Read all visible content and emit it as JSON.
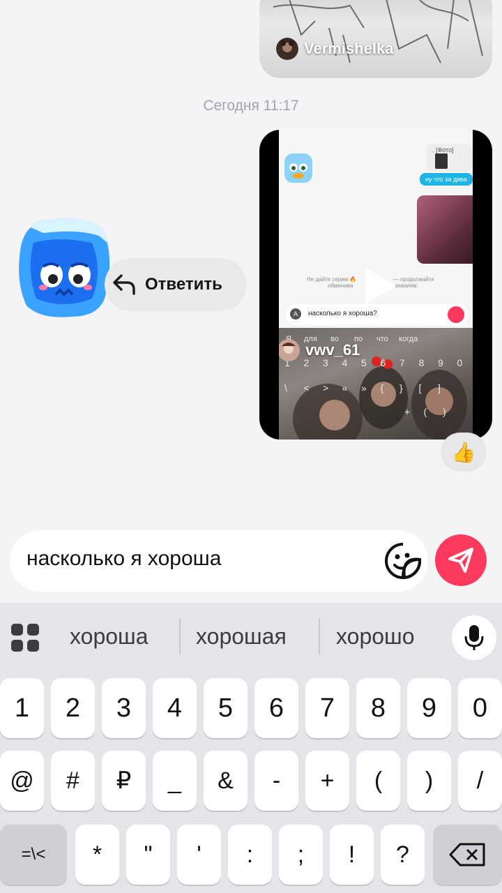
{
  "chat": {
    "prev_video_author": "Vermishelka",
    "date_separator": "Сегодня 11:17",
    "reply_label": "Ответить",
    "main_video": {
      "author": "vwv_61",
      "mini_chat": {
        "top_bubble": ". [Фото]",
        "bubble_text": "ну что за дива",
        "info_left": "Не дайте серим",
        "info_right": "— продолжайте",
        "info_line2_left": "обменива",
        "info_line2_right": "знаниям.",
        "input_text": "насколько я хороша?"
      },
      "mini_keyboard": {
        "suggestions": [
          "Я",
          "для",
          "во",
          "по",
          "что",
          "когда"
        ],
        "digits": [
          "1",
          "2",
          "3",
          "4",
          "5",
          "6",
          "7",
          "8",
          "9",
          "0"
        ],
        "row2": [
          "\\",
          "<",
          ">",
          "«",
          "»",
          "{",
          "}",
          "[",
          "]"
        ],
        "row3": [
          "+",
          "(",
          ")"
        ]
      }
    },
    "reaction": "👍"
  },
  "composer": {
    "value": "насколько я хороша"
  },
  "keyboard": {
    "suggestions": [
      "хороша",
      "хорошая",
      "хорошо"
    ],
    "row1": [
      "1",
      "2",
      "3",
      "4",
      "5",
      "6",
      "7",
      "8",
      "9",
      "0"
    ],
    "row2": [
      "@",
      "#",
      "₽",
      "_",
      "&",
      "-",
      "+",
      "(",
      ")",
      "/"
    ],
    "row3_left": "=\\<",
    "row3": [
      "*",
      "\"",
      "'",
      ":",
      ";",
      "!",
      "?"
    ]
  },
  "colors": {
    "send_button": "#fb3a5e",
    "background": "#f4f4f6",
    "keyboard_bg": "#e5e5e9",
    "mini_bubble_blue": "#1fb4e6"
  }
}
